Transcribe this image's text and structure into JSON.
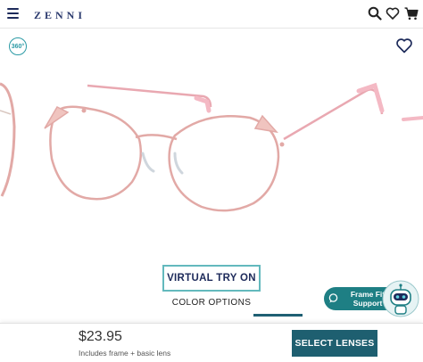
{
  "header": {
    "logo_text": "ZENNI",
    "icons": [
      "menu-icon",
      "search-icon",
      "heart-icon",
      "cart-icon"
    ]
  },
  "product": {
    "badge_360": "360°",
    "frame_color": "#e2a9a6",
    "accent_color": "#f4b9c4"
  },
  "actions": {
    "virtual_try_on": "VIRTUAL TRY ON",
    "color_options": "COLOR OPTIONS"
  },
  "support": {
    "line1": "Frame Fit",
    "line2": "Support"
  },
  "purchase": {
    "price": "$23.95",
    "includes": "Includes frame + basic lens",
    "select_label": "SELECT LENSES"
  },
  "colors": {
    "brand_navy": "#1d2a5a",
    "teal": "#63b9bd",
    "button": "#1e5f70"
  }
}
